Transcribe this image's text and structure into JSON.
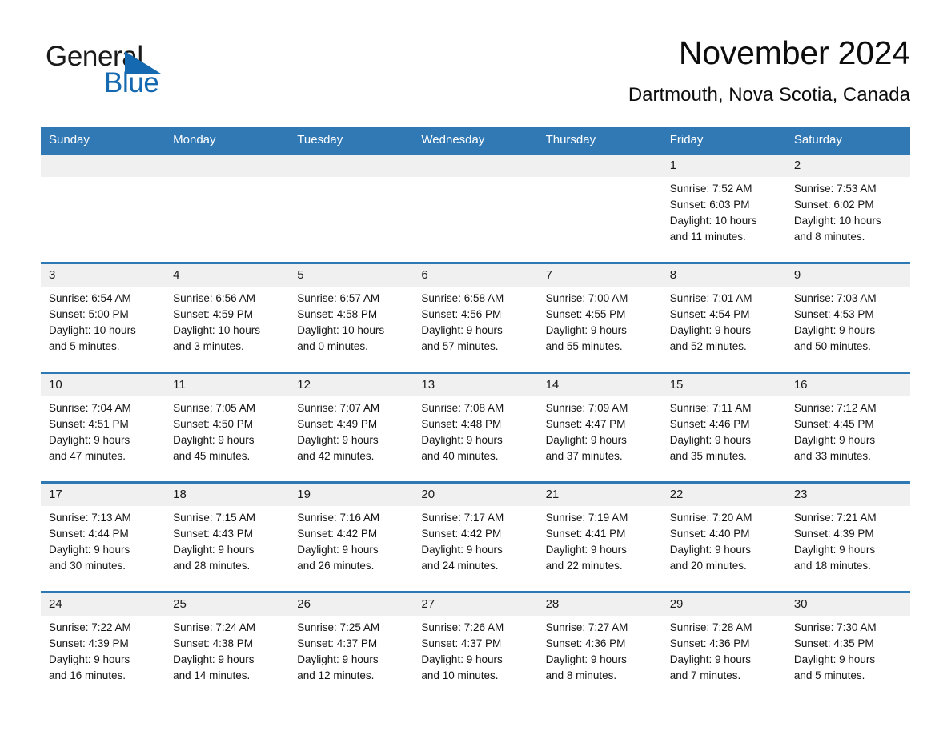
{
  "brand": {
    "line1": "General",
    "line2": "Blue",
    "mark": "triangle-logo",
    "color": "#1569b0"
  },
  "header": {
    "title": "November 2024",
    "subtitle": "Dartmouth, Nova Scotia, Canada"
  },
  "theme": {
    "header_bg": "#3079b5",
    "row_divider": "#2e78b4",
    "daynum_band": "#f0f0f0",
    "text": "#1a1a1a"
  },
  "weekdays": [
    "Sunday",
    "Monday",
    "Tuesday",
    "Wednesday",
    "Thursday",
    "Friday",
    "Saturday"
  ],
  "weeks": [
    {
      "days": [
        {
          "num": "",
          "sunrise": "",
          "sunset": "",
          "daylight1": "",
          "daylight2": ""
        },
        {
          "num": "",
          "sunrise": "",
          "sunset": "",
          "daylight1": "",
          "daylight2": ""
        },
        {
          "num": "",
          "sunrise": "",
          "sunset": "",
          "daylight1": "",
          "daylight2": ""
        },
        {
          "num": "",
          "sunrise": "",
          "sunset": "",
          "daylight1": "",
          "daylight2": ""
        },
        {
          "num": "",
          "sunrise": "",
          "sunset": "",
          "daylight1": "",
          "daylight2": ""
        },
        {
          "num": "1",
          "sunrise": "Sunrise: 7:52 AM",
          "sunset": "Sunset: 6:03 PM",
          "daylight1": "Daylight: 10 hours",
          "daylight2": "and 11 minutes."
        },
        {
          "num": "2",
          "sunrise": "Sunrise: 7:53 AM",
          "sunset": "Sunset: 6:02 PM",
          "daylight1": "Daylight: 10 hours",
          "daylight2": "and 8 minutes."
        }
      ]
    },
    {
      "days": [
        {
          "num": "3",
          "sunrise": "Sunrise: 6:54 AM",
          "sunset": "Sunset: 5:00 PM",
          "daylight1": "Daylight: 10 hours",
          "daylight2": "and 5 minutes."
        },
        {
          "num": "4",
          "sunrise": "Sunrise: 6:56 AM",
          "sunset": "Sunset: 4:59 PM",
          "daylight1": "Daylight: 10 hours",
          "daylight2": "and 3 minutes."
        },
        {
          "num": "5",
          "sunrise": "Sunrise: 6:57 AM",
          "sunset": "Sunset: 4:58 PM",
          "daylight1": "Daylight: 10 hours",
          "daylight2": "and 0 minutes."
        },
        {
          "num": "6",
          "sunrise": "Sunrise: 6:58 AM",
          "sunset": "Sunset: 4:56 PM",
          "daylight1": "Daylight: 9 hours",
          "daylight2": "and 57 minutes."
        },
        {
          "num": "7",
          "sunrise": "Sunrise: 7:00 AM",
          "sunset": "Sunset: 4:55 PM",
          "daylight1": "Daylight: 9 hours",
          "daylight2": "and 55 minutes."
        },
        {
          "num": "8",
          "sunrise": "Sunrise: 7:01 AM",
          "sunset": "Sunset: 4:54 PM",
          "daylight1": "Daylight: 9 hours",
          "daylight2": "and 52 minutes."
        },
        {
          "num": "9",
          "sunrise": "Sunrise: 7:03 AM",
          "sunset": "Sunset: 4:53 PM",
          "daylight1": "Daylight: 9 hours",
          "daylight2": "and 50 minutes."
        }
      ]
    },
    {
      "days": [
        {
          "num": "10",
          "sunrise": "Sunrise: 7:04 AM",
          "sunset": "Sunset: 4:51 PM",
          "daylight1": "Daylight: 9 hours",
          "daylight2": "and 47 minutes."
        },
        {
          "num": "11",
          "sunrise": "Sunrise: 7:05 AM",
          "sunset": "Sunset: 4:50 PM",
          "daylight1": "Daylight: 9 hours",
          "daylight2": "and 45 minutes."
        },
        {
          "num": "12",
          "sunrise": "Sunrise: 7:07 AM",
          "sunset": "Sunset: 4:49 PM",
          "daylight1": "Daylight: 9 hours",
          "daylight2": "and 42 minutes."
        },
        {
          "num": "13",
          "sunrise": "Sunrise: 7:08 AM",
          "sunset": "Sunset: 4:48 PM",
          "daylight1": "Daylight: 9 hours",
          "daylight2": "and 40 minutes."
        },
        {
          "num": "14",
          "sunrise": "Sunrise: 7:09 AM",
          "sunset": "Sunset: 4:47 PM",
          "daylight1": "Daylight: 9 hours",
          "daylight2": "and 37 minutes."
        },
        {
          "num": "15",
          "sunrise": "Sunrise: 7:11 AM",
          "sunset": "Sunset: 4:46 PM",
          "daylight1": "Daylight: 9 hours",
          "daylight2": "and 35 minutes."
        },
        {
          "num": "16",
          "sunrise": "Sunrise: 7:12 AM",
          "sunset": "Sunset: 4:45 PM",
          "daylight1": "Daylight: 9 hours",
          "daylight2": "and 33 minutes."
        }
      ]
    },
    {
      "days": [
        {
          "num": "17",
          "sunrise": "Sunrise: 7:13 AM",
          "sunset": "Sunset: 4:44 PM",
          "daylight1": "Daylight: 9 hours",
          "daylight2": "and 30 minutes."
        },
        {
          "num": "18",
          "sunrise": "Sunrise: 7:15 AM",
          "sunset": "Sunset: 4:43 PM",
          "daylight1": "Daylight: 9 hours",
          "daylight2": "and 28 minutes."
        },
        {
          "num": "19",
          "sunrise": "Sunrise: 7:16 AM",
          "sunset": "Sunset: 4:42 PM",
          "daylight1": "Daylight: 9 hours",
          "daylight2": "and 26 minutes."
        },
        {
          "num": "20",
          "sunrise": "Sunrise: 7:17 AM",
          "sunset": "Sunset: 4:42 PM",
          "daylight1": "Daylight: 9 hours",
          "daylight2": "and 24 minutes."
        },
        {
          "num": "21",
          "sunrise": "Sunrise: 7:19 AM",
          "sunset": "Sunset: 4:41 PM",
          "daylight1": "Daylight: 9 hours",
          "daylight2": "and 22 minutes."
        },
        {
          "num": "22",
          "sunrise": "Sunrise: 7:20 AM",
          "sunset": "Sunset: 4:40 PM",
          "daylight1": "Daylight: 9 hours",
          "daylight2": "and 20 minutes."
        },
        {
          "num": "23",
          "sunrise": "Sunrise: 7:21 AM",
          "sunset": "Sunset: 4:39 PM",
          "daylight1": "Daylight: 9 hours",
          "daylight2": "and 18 minutes."
        }
      ]
    },
    {
      "days": [
        {
          "num": "24",
          "sunrise": "Sunrise: 7:22 AM",
          "sunset": "Sunset: 4:39 PM",
          "daylight1": "Daylight: 9 hours",
          "daylight2": "and 16 minutes."
        },
        {
          "num": "25",
          "sunrise": "Sunrise: 7:24 AM",
          "sunset": "Sunset: 4:38 PM",
          "daylight1": "Daylight: 9 hours",
          "daylight2": "and 14 minutes."
        },
        {
          "num": "26",
          "sunrise": "Sunrise: 7:25 AM",
          "sunset": "Sunset: 4:37 PM",
          "daylight1": "Daylight: 9 hours",
          "daylight2": "and 12 minutes."
        },
        {
          "num": "27",
          "sunrise": "Sunrise: 7:26 AM",
          "sunset": "Sunset: 4:37 PM",
          "daylight1": "Daylight: 9 hours",
          "daylight2": "and 10 minutes."
        },
        {
          "num": "28",
          "sunrise": "Sunrise: 7:27 AM",
          "sunset": "Sunset: 4:36 PM",
          "daylight1": "Daylight: 9 hours",
          "daylight2": "and 8 minutes."
        },
        {
          "num": "29",
          "sunrise": "Sunrise: 7:28 AM",
          "sunset": "Sunset: 4:36 PM",
          "daylight1": "Daylight: 9 hours",
          "daylight2": "and 7 minutes."
        },
        {
          "num": "30",
          "sunrise": "Sunrise: 7:30 AM",
          "sunset": "Sunset: 4:35 PM",
          "daylight1": "Daylight: 9 hours",
          "daylight2": "and 5 minutes."
        }
      ]
    }
  ]
}
